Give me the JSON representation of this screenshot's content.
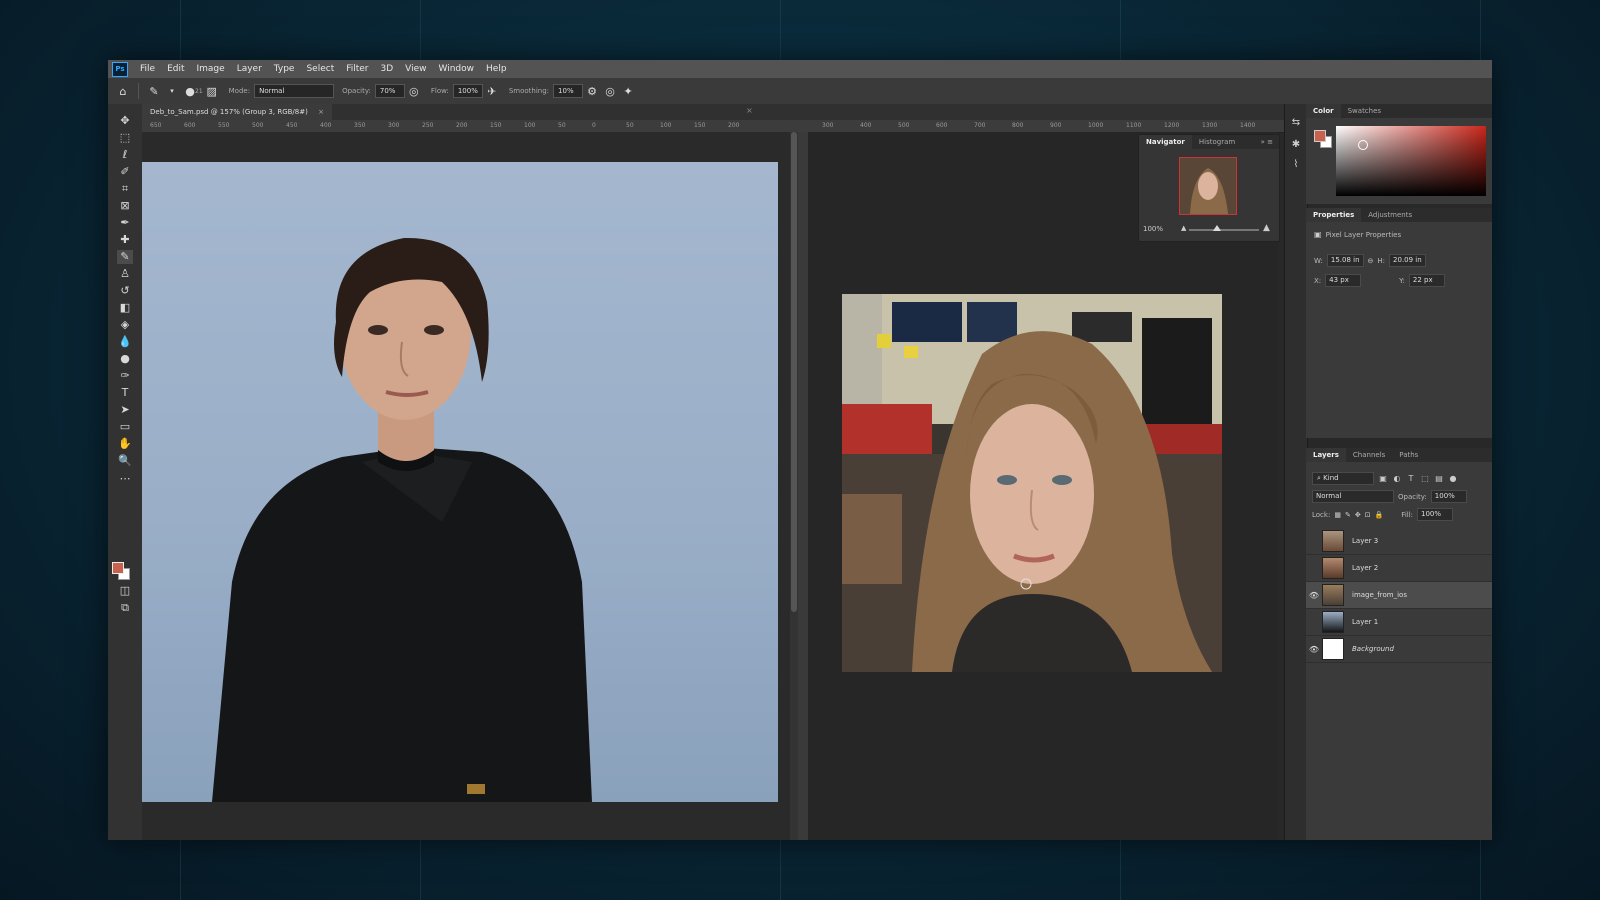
{
  "app": {
    "logo_text": "Ps",
    "menu": [
      "File",
      "Edit",
      "Image",
      "Layer",
      "Type",
      "Select",
      "Filter",
      "3D",
      "View",
      "Window",
      "Help"
    ]
  },
  "options_bar": {
    "brush_size": "21",
    "mode_label": "Mode:",
    "mode_value": "Normal",
    "opacity_label": "Opacity:",
    "opacity_value": "70%",
    "flow_label": "Flow:",
    "flow_value": "100%",
    "smoothing_label": "Smoothing:",
    "smoothing_value": "10%"
  },
  "document": {
    "tab_title": "Deb_to_Sam.psd @ 157% (Group 3, RGB/8#)",
    "tab_close": "×",
    "second_close": "×"
  },
  "ruler": {
    "left_ticks": [
      "650",
      "600",
      "550",
      "500",
      "450",
      "400",
      "350",
      "300",
      "250",
      "200",
      "150",
      "100",
      "50",
      "0",
      "50",
      "100",
      "150",
      "200"
    ],
    "right_ticks": [
      "300",
      "400",
      "500",
      "600",
      "700",
      "800",
      "900",
      "1000",
      "1100",
      "1200",
      "1300",
      "1400"
    ]
  },
  "navigator": {
    "tabs": [
      "Navigator",
      "Histogram"
    ],
    "zoom": "100%"
  },
  "color_panel": {
    "tabs": [
      "Color",
      "Swatches"
    ],
    "fg_color": "#c9614f",
    "bg_color": "#ffffff"
  },
  "properties_panel": {
    "tabs": [
      "Properties",
      "Adjustments"
    ],
    "heading": "Pixel Layer Properties",
    "w_label": "W:",
    "w_value": "15.08 in",
    "h_label": "H:",
    "h_value": "20.09 in",
    "x_label": "X:",
    "x_value": "43 px",
    "y_label": "Y:",
    "y_value": "22 px"
  },
  "layers_panel": {
    "tabs": [
      "Layers",
      "Channels",
      "Paths"
    ],
    "filter_value": "Kind",
    "blend_mode": "Normal",
    "opacity_label": "Opacity:",
    "opacity_value": "100%",
    "lock_label": "Lock:",
    "fill_label": "Fill:",
    "fill_value": "100%",
    "layers": [
      {
        "name": "Layer 3",
        "visible": false,
        "selected": false
      },
      {
        "name": "Layer 2",
        "visible": false,
        "selected": false
      },
      {
        "name": "image_from_ios",
        "visible": true,
        "selected": true
      },
      {
        "name": "Layer 1",
        "visible": false,
        "selected": false
      },
      {
        "name": "Background",
        "visible": true,
        "selected": false
      }
    ]
  }
}
